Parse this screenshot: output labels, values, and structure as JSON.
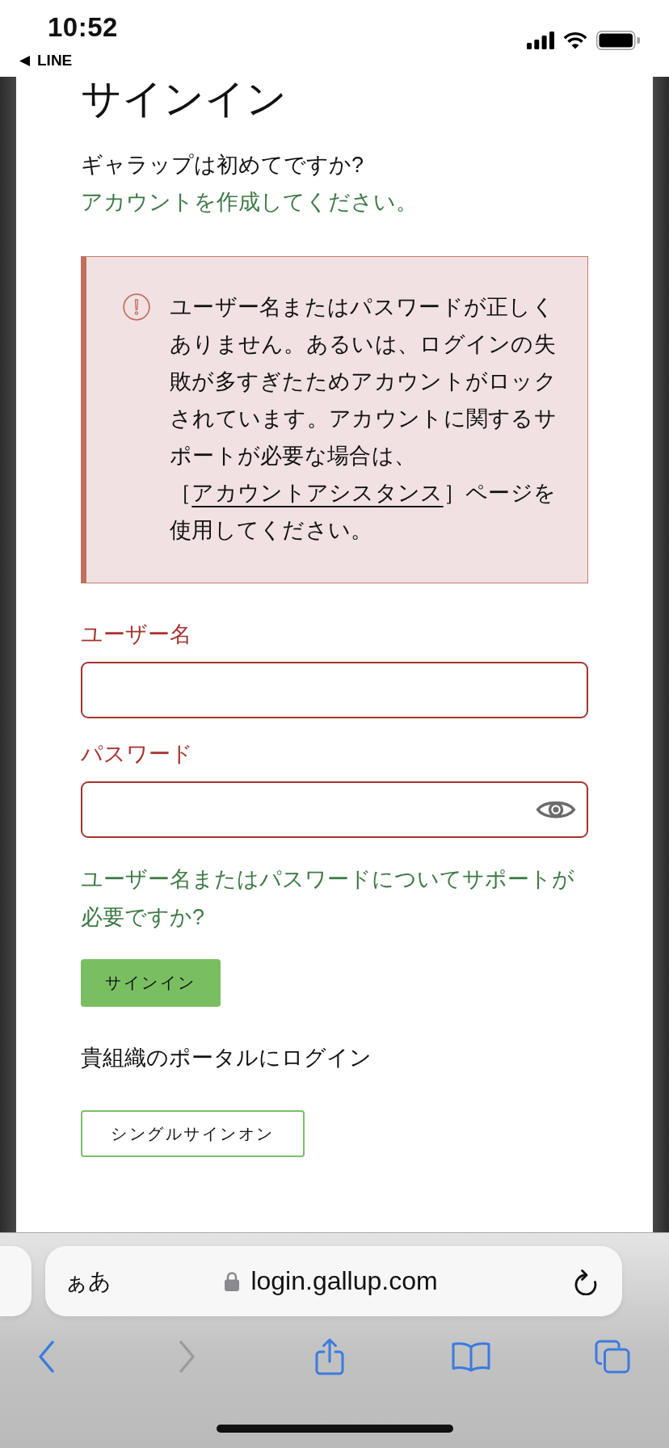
{
  "status_bar": {
    "time": "10:52",
    "back_label": "LINE"
  },
  "page": {
    "title": "サインイン",
    "intro": "ギャラップは初めてですか?",
    "intro_link": "アカウントを作成してください。"
  },
  "error": {
    "message": "ユーザー名またはパスワードが正しくありません。あるいは、ログインの失敗が多すぎたためアカウントがロックされています。アカウントに関するサポートが必要な場合は、［",
    "link": "アカウントアシスタンス",
    "message_end": "］ページを使用してください。"
  },
  "fields": [
    {
      "label": "ユーザー名",
      "kind": "text",
      "invalid": true
    },
    {
      "label": "パスワード",
      "kind": "password",
      "invalid": true
    }
  ],
  "help_link": "ユーザー名またはパスワードについてサポートが必要ですか?",
  "sign_in_button": "サインイン",
  "org_prompt": "貴組織のポータルにログイン",
  "sso_button": "シングルサインオン",
  "browser": {
    "text_size_button": "ぁあ",
    "url": "login.gallup.com",
    "toolbar": [
      {
        "kind": "back",
        "disabled": false
      },
      {
        "kind": "forward",
        "disabled": true
      },
      {
        "kind": "share",
        "disabled": false
      },
      {
        "kind": "bookmarks",
        "disabled": false
      },
      {
        "kind": "tabs",
        "disabled": false
      }
    ]
  }
}
